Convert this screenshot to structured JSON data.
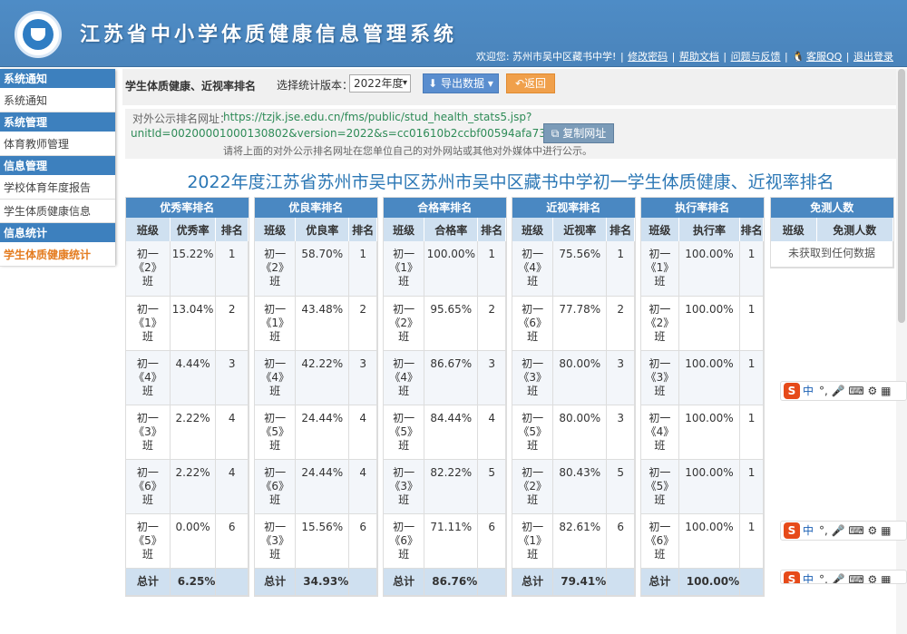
{
  "header": {
    "title": "江苏省中小学体质健康信息管理系统",
    "welcome": "欢迎您: 苏州市吴中区藏书中学!",
    "links": [
      "修改密码",
      "帮助文档",
      "问题与反馈",
      "客服QQ",
      "退出登录"
    ]
  },
  "sidebar": {
    "sections": [
      {
        "title": "系统通知",
        "items": [
          {
            "label": "系统通知"
          }
        ]
      },
      {
        "title": "系统管理",
        "items": [
          {
            "label": "体育教师管理"
          }
        ]
      },
      {
        "title": "信息管理",
        "items": [
          {
            "label": "学校体育年度报告"
          },
          {
            "label": "学生体质健康信息"
          }
        ]
      },
      {
        "title": "信息统计",
        "items": [
          {
            "label": "学生体质健康统计"
          }
        ]
      }
    ]
  },
  "toolbar": {
    "heading": "学生体质健康、近视率排名",
    "version_label": "选择统计版本：",
    "version_value": "2022年度",
    "export_label": "导出数据",
    "back_label": "返回"
  },
  "public_url": {
    "label": "对外公示排名网址：",
    "line1": "https://tzjk.jse.edu.cn/fms/public/stud_health_stats5.jsp?",
    "line2": "unitId=00200001000130802&version=2022&s=cc01610b2ccbf00594afa73752cefebe",
    "copy_label": "复制网址",
    "hint": "请将上面的对外公示排名网址在您单位自己的对外网站或其他对外媒体中进行公示。"
  },
  "report_title": "2022年度江苏省苏州市吴中区苏州市吴中区藏书中学初一学生体质健康、近视率排名",
  "tables": [
    {
      "caption": "优秀率排名",
      "cols": [
        "班级",
        "优秀率",
        "排名"
      ],
      "rows": [
        [
          "初一\n《2》\n班",
          "15.22%",
          "1"
        ],
        [
          "初一\n《1》\n班",
          "13.04%",
          "2"
        ],
        [
          "初一\n《4》\n班",
          "4.44%",
          "3"
        ],
        [
          "初一\n《3》\n班",
          "2.22%",
          "4"
        ],
        [
          "初一\n《6》\n班",
          "2.22%",
          "4"
        ],
        [
          "初一\n《5》\n班",
          "0.00%",
          "6"
        ]
      ],
      "total": [
        "总计",
        "6.25%",
        ""
      ]
    },
    {
      "caption": "优良率排名",
      "cols": [
        "班级",
        "优良率",
        "排名"
      ],
      "rows": [
        [
          "初一\n《2》\n班",
          "58.70%",
          "1"
        ],
        [
          "初一\n《1》\n班",
          "43.48%",
          "2"
        ],
        [
          "初一\n《4》\n班",
          "42.22%",
          "3"
        ],
        [
          "初一\n《5》\n班",
          "24.44%",
          "4"
        ],
        [
          "初一\n《6》\n班",
          "24.44%",
          "4"
        ],
        [
          "初一\n《3》\n班",
          "15.56%",
          "6"
        ]
      ],
      "total": [
        "总计",
        "34.93%",
        ""
      ]
    },
    {
      "caption": "合格率排名",
      "cols": [
        "班级",
        "合格率",
        "排名"
      ],
      "rows": [
        [
          "初一\n《1》\n班",
          "100.00%",
          "1"
        ],
        [
          "初一\n《2》\n班",
          "95.65%",
          "2"
        ],
        [
          "初一\n《4》\n班",
          "86.67%",
          "3"
        ],
        [
          "初一\n《5》\n班",
          "84.44%",
          "4"
        ],
        [
          "初一\n《3》\n班",
          "82.22%",
          "5"
        ],
        [
          "初一\n《6》\n班",
          "71.11%",
          "6"
        ]
      ],
      "total": [
        "总计",
        "86.76%",
        ""
      ]
    },
    {
      "caption": "近视率排名",
      "cols": [
        "班级",
        "近视率",
        "排名"
      ],
      "rows": [
        [
          "初一\n《4》\n班",
          "75.56%",
          "1"
        ],
        [
          "初一\n《6》\n班",
          "77.78%",
          "2"
        ],
        [
          "初一\n《3》\n班",
          "80.00%",
          "3"
        ],
        [
          "初一\n《5》\n班",
          "80.00%",
          "3"
        ],
        [
          "初一\n《2》\n班",
          "80.43%",
          "5"
        ],
        [
          "初一\n《1》\n班",
          "82.61%",
          "6"
        ]
      ],
      "total": [
        "总计",
        "79.41%",
        ""
      ]
    },
    {
      "caption": "执行率排名",
      "cols": [
        "班级",
        "执行率",
        "排名"
      ],
      "rows": [
        [
          "初一\n《1》\n班",
          "100.00%",
          "1"
        ],
        [
          "初一\n《2》\n班",
          "100.00%",
          "1"
        ],
        [
          "初一\n《3》\n班",
          "100.00%",
          "1"
        ],
        [
          "初一\n《4》\n班",
          "100.00%",
          "1"
        ],
        [
          "初一\n《5》\n班",
          "100.00%",
          "1"
        ],
        [
          "初一\n《6》\n班",
          "100.00%",
          "1"
        ]
      ],
      "total": [
        "总计",
        "100.00%",
        ""
      ]
    }
  ],
  "exempt_table": {
    "caption": "免测人数",
    "cols": [
      "班级",
      "免测人数"
    ],
    "empty_text": "未获取到任何数据"
  },
  "ime_bar": {
    "label": "中",
    "punct": "°,"
  }
}
